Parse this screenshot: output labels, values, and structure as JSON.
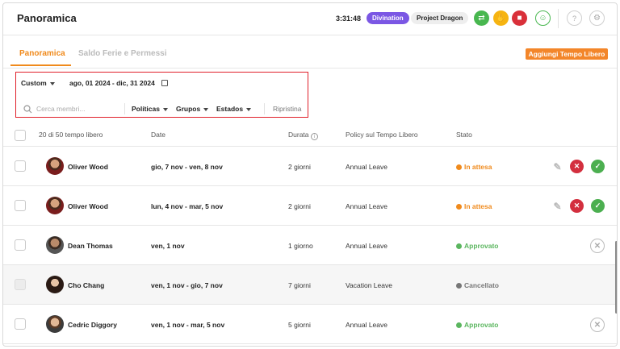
{
  "header": {
    "title": "Panoramica",
    "timer": "3:31:48",
    "activity_badge": "Divination",
    "project_badge": "Project Dragon",
    "icons": [
      "swap-icon",
      "hand-icon",
      "stop-icon",
      "user-icon",
      "help-icon",
      "settings-icon"
    ]
  },
  "tabs": [
    {
      "label": "Panoramica",
      "active": true
    },
    {
      "label": "Saldo Ferie e Permessi",
      "active": false
    }
  ],
  "add_button": "Aggiungi Tempo Libero",
  "filters": {
    "range_mode": "Custom",
    "date_range": "ago, 01 2024 - dic, 31 2024",
    "search_placeholder": "Cerca membri...",
    "policies": "Políticas",
    "groups": "Grupos",
    "states": "Estados",
    "reset": "Ripristina"
  },
  "table": {
    "count": "20 di 50 tempo libero",
    "columns": [
      "Date",
      "Durata",
      "Policy sul Tempo Libero",
      "Stato"
    ],
    "rows": [
      {
        "name": "Oliver Wood",
        "dates": "gio, 7 nov - ven, 8 nov",
        "duration": "2 giorni",
        "policy": "Annual Leave",
        "status": "In attesa",
        "status_kind": "pending"
      },
      {
        "name": "Oliver Wood",
        "dates": "lun, 4 nov - mar, 5 nov",
        "duration": "2 giorni",
        "policy": "Annual Leave",
        "status": "In attesa",
        "status_kind": "pending"
      },
      {
        "name": "Dean Thomas",
        "dates": "ven, 1 nov",
        "duration": "1 giorno",
        "policy": "Annual Leave",
        "status": "Approvato",
        "status_kind": "approved"
      },
      {
        "name": "Cho Chang",
        "dates": "ven, 1 nov - gio, 7 nov",
        "duration": "7 giorni",
        "policy": "Vacation Leave",
        "status": "Cancellato",
        "status_kind": "cancelled"
      },
      {
        "name": "Cedric Diggory",
        "dates": "ven, 1 nov - mar, 5 nov",
        "duration": "5 giorni",
        "policy": "Annual Leave",
        "status": "Approvato",
        "status_kind": "approved"
      }
    ]
  },
  "colors": {
    "accent": "#f08a1c",
    "badge_purple": "#7b57e4",
    "approved": "#5bb65f",
    "reject": "#d32f3e",
    "accept": "#4caf50"
  }
}
